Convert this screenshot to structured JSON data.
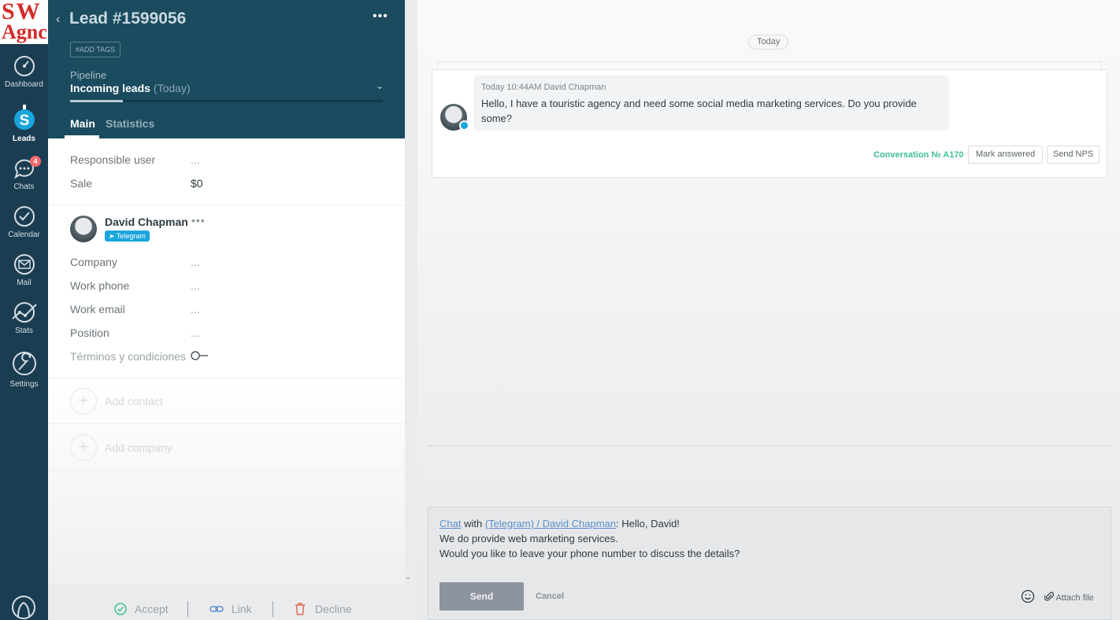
{
  "logo": {
    "line1": "SW",
    "line2": "Agnc",
    "color": "#d42a2a"
  },
  "nav": {
    "items": [
      {
        "label": "Dashboard",
        "icon": "dashboard-icon"
      },
      {
        "label": "Leads",
        "icon": "leads-icon"
      },
      {
        "label": "Chats",
        "icon": "chats-icon",
        "badge": "4"
      },
      {
        "label": "Calendar",
        "icon": "calendar-icon"
      },
      {
        "label": "Mail",
        "icon": "mail-icon"
      },
      {
        "label": "Stats",
        "icon": "stats-icon"
      },
      {
        "label": "Settings",
        "icon": "settings-icon"
      }
    ],
    "active": "Leads"
  },
  "lead": {
    "title": "Lead #1599056",
    "add_tags": "#ADD TAGS",
    "pipeline_label": "Pipeline",
    "pipeline_value": "Incoming leads",
    "pipeline_when": "(Today)",
    "pipeline_progress": 0.17,
    "tabs": [
      "Main",
      "Statistics"
    ],
    "fields": {
      "responsible_label": "Responsible user",
      "responsible_value": "...",
      "sale_label": "Sale",
      "sale_value": "$0"
    }
  },
  "contact": {
    "name": "David Chapman",
    "channel": "Telegram",
    "fields": [
      {
        "label": "Company",
        "value": "..."
      },
      {
        "label": "Work phone",
        "value": "..."
      },
      {
        "label": "Work email",
        "value": "..."
      },
      {
        "label": "Position",
        "value": "..."
      }
    ],
    "terms_label": "Términos y condiciones"
  },
  "add_contact": "Add contact",
  "add_company": "Add company",
  "footer": {
    "accept": "Accept",
    "link": "Link",
    "decline": "Decline"
  },
  "chat": {
    "date_pill": "Today",
    "message": {
      "meta": "Today 10:44AM David Chapman",
      "text": "Hello, I have a touristic agency and need some social media marketing services. Do you provide some?"
    },
    "conversation": "Conversation № A170",
    "mark_answered": "Mark answered",
    "send_nps": "Send NPS"
  },
  "composer": {
    "chat_link": "Chat",
    "with_text": " with ",
    "recipient_link": "(Telegram) / David Chapman",
    "greeting": ": Hello, David!",
    "line2": "We do provide web marketing services.",
    "line3": "Would you like to leave your phone number to discuss the details?",
    "send": "Send",
    "cancel": "Cancel",
    "attach": "Attach file"
  },
  "colors": {
    "nav_bg": "#1b3d52",
    "header_bg": "#1a4b5e",
    "telegram": "#1aa5dd",
    "conversation": "#3fbf94",
    "badge": "#f36a6a"
  }
}
